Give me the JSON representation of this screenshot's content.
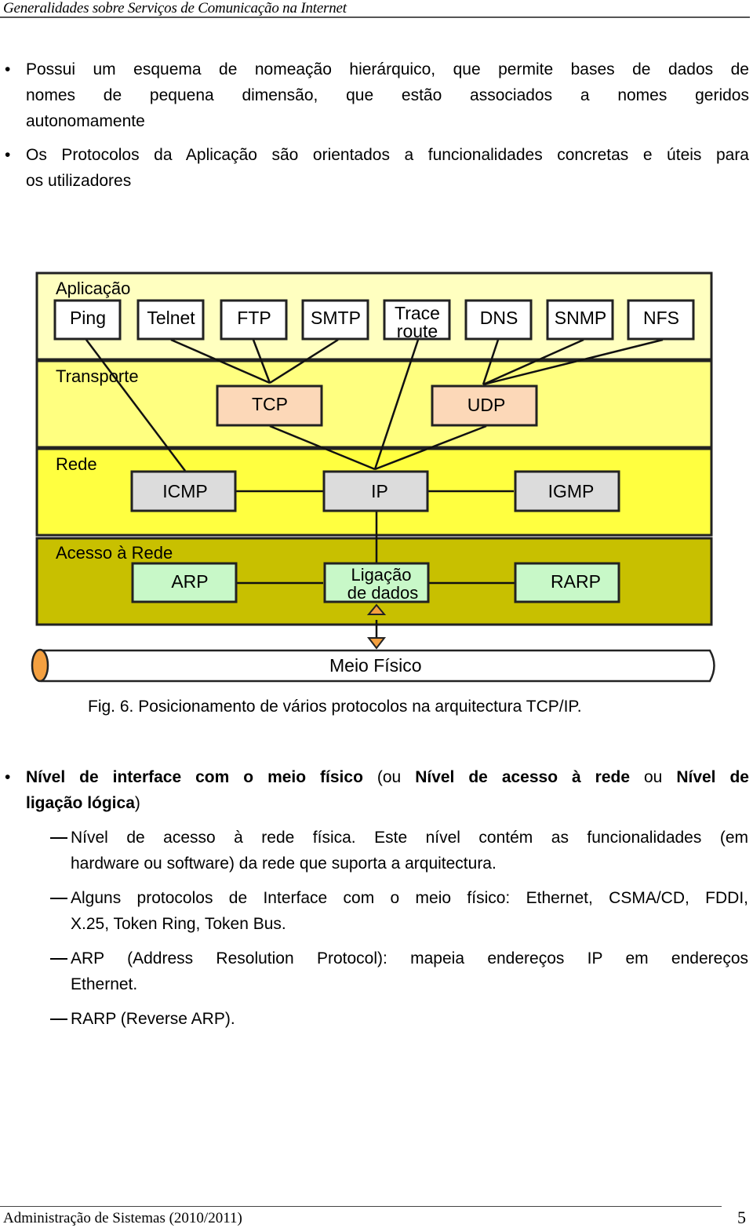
{
  "header": {
    "title": "Generalidades sobre Serviços de Comunicação na Internet"
  },
  "intro_bullets": [
    {
      "lines": [
        "Possui um esquema de nomeação hierárquico, que permite bases de dados de",
        "nomes de pequena dimensão, que estão associados a nomes geridos",
        "autonomamente"
      ]
    },
    {
      "lines": [
        "Os Protocolos da Aplicação são orientados a funcionalidades concretas e úteis para",
        "os utilizadores"
      ]
    }
  ],
  "diagram": {
    "layers": [
      {
        "label": "Aplicação",
        "color": "#ffffc0"
      },
      {
        "label": "Transporte",
        "color": "#ffff80"
      },
      {
        "label": "Rede",
        "color": "#ffff40"
      },
      {
        "label": "Acesso à Rede",
        "color": "#c8c000"
      }
    ],
    "application_protocols": [
      "Ping",
      "Telnet",
      "FTP",
      "SMTP",
      "Trace route",
      "DNS",
      "SNMP",
      "NFS"
    ],
    "trace_route_lines": [
      "Trace",
      "route"
    ],
    "transport_protocols": [
      "TCP",
      "UDP"
    ],
    "network_protocols": [
      "ICMP",
      "IP",
      "IGMP"
    ],
    "access_protocols": [
      "ARP",
      "Ligação de dados",
      "RARP"
    ],
    "data_link_lines": [
      "Ligação",
      "de dados"
    ],
    "physical_medium": "Meio Físico",
    "colors": {
      "app_box": "#ffffff",
      "transport_box": "#fcd8b8",
      "network_box": "#dcdcdc",
      "access_box": "#c8f8c8",
      "cable_end": "#f4a040",
      "arrow": "#f4a040"
    }
  },
  "caption": "Fig. 6. Posicionamento de vários protocolos na arquitectura TCP/IP.",
  "section": {
    "bullet_parts": [
      {
        "text": "Nível de interface com o meio físico",
        "bold": true
      },
      {
        "text": " (ou ",
        "bold": false
      },
      {
        "text": "Nível de acesso à rede",
        "bold": true
      },
      {
        "text": " ou ",
        "bold": false
      },
      {
        "text": "Nível de",
        "bold": true
      }
    ],
    "bullet_line2_bold": "ligação lógica",
    "bullet_line2_rest": ")",
    "subitems": [
      {
        "lines": [
          "Nível de acesso à rede física. Este nível contém as funcionalidades (em",
          "hardware ou software) da rede que suporta a arquitectura."
        ]
      },
      {
        "lines": [
          "Alguns protocolos de Interface com o meio físico: Ethernet, CSMA/CD, FDDI,",
          "X.25, Token Ring, Token Bus."
        ]
      },
      {
        "lines": [
          "ARP (Address Resolution Protocol): mapeia endereços IP em endereços",
          "Ethernet."
        ]
      },
      {
        "lines": [
          "RARP (Reverse ARP)."
        ]
      }
    ]
  },
  "footer": {
    "left": "Administração de Sistemas (2010/2011)",
    "page_number": "5"
  }
}
